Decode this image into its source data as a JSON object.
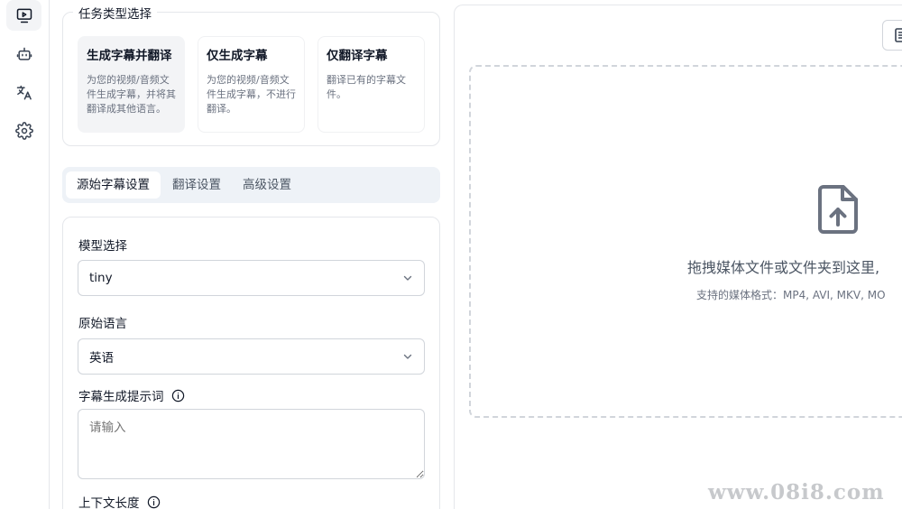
{
  "sidebar": {
    "items": [
      {
        "icon": "video-play-icon",
        "active": true
      },
      {
        "icon": "robot-icon",
        "active": false
      },
      {
        "icon": "translate-icon",
        "active": false
      },
      {
        "icon": "gear-icon",
        "active": false
      }
    ]
  },
  "task_type": {
    "title": "任务类型选择",
    "options": [
      {
        "title": "生成字幕并翻译",
        "desc": "为您的视频/音频文件生成字幕，并将其翻译成其他语言。",
        "selected": true
      },
      {
        "title": "仅生成字幕",
        "desc": "为您的视频/音频文件生成字幕，不进行翻译。",
        "selected": false
      },
      {
        "title": "仅翻译字幕",
        "desc": "翻译已有的字幕文件。",
        "selected": false
      }
    ]
  },
  "tabs": [
    {
      "label": "源始字幕设置",
      "active": true
    },
    {
      "label": "翻译设置",
      "active": false
    },
    {
      "label": "高级设置",
      "active": false
    }
  ],
  "settings": {
    "model_label": "模型选择",
    "model_value": "tiny",
    "language_label": "原始语言",
    "language_value": "英语",
    "prompt_label": "字幕生成提示词",
    "prompt_placeholder": "请输入",
    "context_label": "上下文长度"
  },
  "dropzone": {
    "main_text": "拖拽媒体文件或文件夹到这里,",
    "sub_text": "支持的媒体格式：MP4, AVI, MKV, MO"
  },
  "watermark": "www.08i8.com",
  "colors": {
    "border": "#e5e7eb",
    "selected_bg": "#f3f4f6",
    "tabs_bg": "#eef2f7",
    "icon": "#6b7280"
  }
}
